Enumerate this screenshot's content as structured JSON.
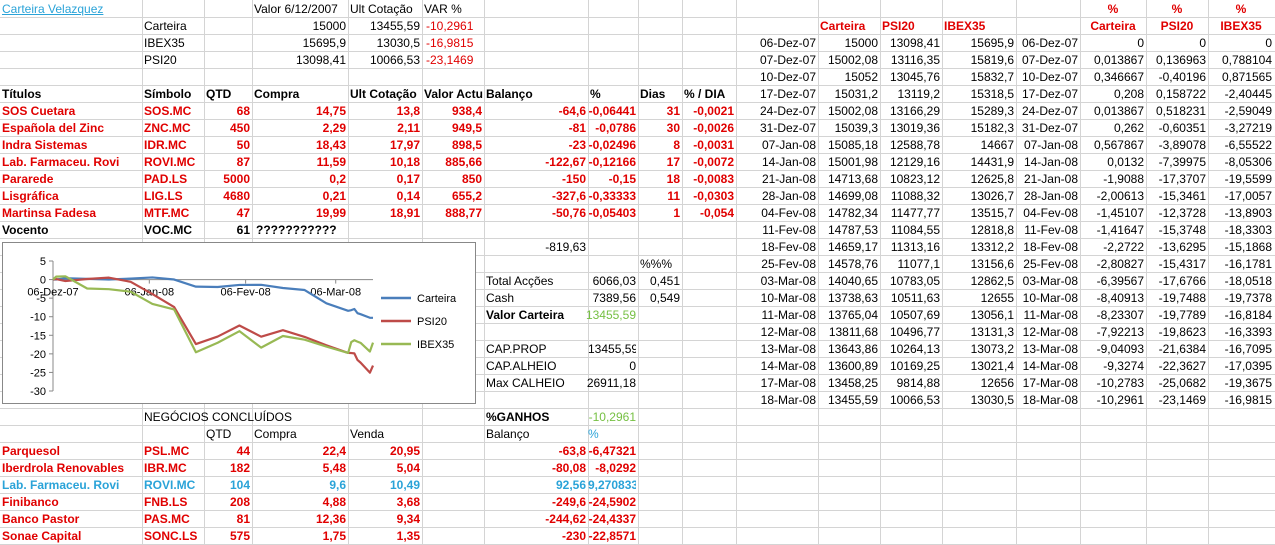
{
  "title": "Carteira Velazquez",
  "summary": {
    "headers": [
      "Valor 6/12/2007",
      "Ult Cotação",
      "VAR %"
    ],
    "rows": [
      {
        "name": "Carteira",
        "v1": "15000",
        "v2": "13455,59",
        "v3": "-10,2961"
      },
      {
        "name": "IBEX35",
        "v1": "15695,9",
        "v2": "13030,5",
        "v3": "-16,9815"
      },
      {
        "name": "PSI20",
        "v1": "13098,41",
        "v2": "10066,53",
        "v3": "-23,1469"
      }
    ]
  },
  "portfolio": {
    "headers": [
      "Títulos",
      "Símbolo",
      "QTD",
      "Compra",
      "Ult Cotação",
      "Valor Actu",
      "Balanço",
      "%",
      "Dias",
      "% / DIA"
    ],
    "rows": [
      [
        "SOS Cuetara",
        "SOS.MC",
        "68",
        "14,75",
        "13,8",
        "938,4",
        "-64,6",
        "-0,06441",
        "31",
        "-0,0021"
      ],
      [
        "Española del Zinc",
        "ZNC.MC",
        "450",
        "2,29",
        "2,11",
        "949,5",
        "-81",
        "-0,0786",
        "30",
        "-0,0026"
      ],
      [
        "Indra Sistemas",
        "IDR.MC",
        "50",
        "18,43",
        "17,97",
        "898,5",
        "-23",
        "-0,02496",
        "8",
        "-0,0031"
      ],
      [
        "Lab. Farmaceu. Rovi",
        "ROVI.MC",
        "87",
        "11,59",
        "10,18",
        "885,66",
        "-122,67",
        "-0,12166",
        "17",
        "-0,0072"
      ],
      [
        "Pararede",
        "PAD.LS",
        "5000",
        "0,2",
        "0,17",
        "850",
        "-150",
        "-0,15",
        "18",
        "-0,0083"
      ],
      [
        "Lisgráfica",
        "LIG.LS",
        "4680",
        "0,21",
        "0,14",
        "655,2",
        "-327,6",
        "-0,33333",
        "11",
        "-0,0303"
      ],
      [
        "Martinsa Fadesa",
        "MTF.MC",
        "47",
        "19,99",
        "18,91",
        "888,77",
        "-50,76",
        "-0,05403",
        "1",
        "-0,054"
      ]
    ],
    "vocento": [
      "Vocento",
      "VOC.MC",
      "61",
      "???????????"
    ]
  },
  "totals": {
    "balance_total": "-819,63",
    "pct_header": "%%%",
    "total_accoes_label": "Total Acções",
    "total_accoes": "6066,03",
    "total_accoes_pct": "0,451",
    "cash_label": "Cash",
    "cash": "7389,56",
    "cash_pct": "0,549",
    "valor_carteira_label": "Valor Carteira",
    "valor_carteira": "13455,59",
    "cap_prop_label": "CAP.PROP",
    "cap_prop": "13455,59",
    "cap_alheio_label": "CAP.ALHEIO",
    "cap_alheio": "0",
    "max_calheio_label": "Max CALHEIO",
    "max_calheio": "26911,18",
    "ganhos_label": "%GANHOS",
    "ganhos": "-10,2961",
    "balanco_label": "Balanço",
    "balanco_pct_label": "%"
  },
  "closed": {
    "title": "NEGÓCIOS CONCLUÍDOS",
    "headers": [
      "QTD",
      "Compra",
      "Venda"
    ],
    "rows": [
      [
        "Parquesol",
        "PSL.MC",
        "44",
        "22,4",
        "20,95",
        "-63,8",
        "-6,47321"
      ],
      [
        "Iberdrola Renovables",
        "IBR.MC",
        "182",
        "5,48",
        "5,04",
        "-80,08",
        "-8,0292"
      ],
      [
        "Lab. Farmaceu. Rovi",
        "ROVI.MC",
        "104",
        "9,6",
        "10,49",
        "92,56",
        "9,270833"
      ],
      [
        "Finibanco",
        "FNB.LS",
        "208",
        "4,88",
        "3,68",
        "-249,6",
        "-24,5902"
      ],
      [
        "Banco Pastor",
        "PAS.MC",
        "81",
        "12,36",
        "9,34",
        "-244,62",
        "-24,4337"
      ],
      [
        "Sonae Capital",
        "SONC.LS",
        "575",
        "1,75",
        "1,35",
        "-230",
        "-22,8571"
      ]
    ]
  },
  "history": {
    "headers": [
      "Carteira",
      "PSI20",
      "IBEX35"
    ],
    "pct_headers": [
      "%",
      "%",
      "%"
    ],
    "pct_names": [
      "Carteira",
      "PSI20",
      "IBEX35"
    ],
    "rows": [
      [
        "06-Dez-07",
        "15000",
        "13098,41",
        "15695,9",
        "06-Dez-07",
        "0",
        "0",
        "0"
      ],
      [
        "07-Dez-07",
        "15002,08",
        "13116,35",
        "15819,6",
        "07-Dez-07",
        "0,013867",
        "0,136963",
        "0,788104"
      ],
      [
        "10-Dez-07",
        "15052",
        "13045,76",
        "15832,7",
        "10-Dez-07",
        "0,346667",
        "-0,40196",
        "0,871565"
      ],
      [
        "17-Dez-07",
        "15031,2",
        "13119,2",
        "15318,5",
        "17-Dez-07",
        "0,208",
        "0,158722",
        "-2,40445"
      ],
      [
        "24-Dez-07",
        "15002,08",
        "13166,29",
        "15289,3",
        "24-Dez-07",
        "0,013867",
        "0,518231",
        "-2,59049"
      ],
      [
        "31-Dez-07",
        "15039,3",
        "13019,36",
        "15182,3",
        "31-Dez-07",
        "0,262",
        "-0,60351",
        "-3,27219"
      ],
      [
        "07-Jan-08",
        "15085,18",
        "12588,78",
        "14667",
        "07-Jan-08",
        "0,567867",
        "-3,89078",
        "-6,55522"
      ],
      [
        "14-Jan-08",
        "15001,98",
        "12129,16",
        "14431,9",
        "14-Jan-08",
        "0,0132",
        "-7,39975",
        "-8,05306"
      ],
      [
        "21-Jan-08",
        "14713,68",
        "10823,12",
        "12625,8",
        "21-Jan-08",
        "-1,9088",
        "-17,3707",
        "-19,5599"
      ],
      [
        "28-Jan-08",
        "14699,08",
        "11088,32",
        "13026,7",
        "28-Jan-08",
        "-2,00613",
        "-15,3461",
        "-17,0057"
      ],
      [
        "04-Fev-08",
        "14782,34",
        "11477,77",
        "13515,7",
        "04-Fev-08",
        "-1,45107",
        "-12,3728",
        "-13,8903"
      ],
      [
        "11-Fev-08",
        "14787,53",
        "11084,55",
        "12818,8",
        "11-Fev-08",
        "-1,41647",
        "-15,3748",
        "-18,3303"
      ],
      [
        "18-Fev-08",
        "14659,17",
        "11313,16",
        "13312,2",
        "18-Fev-08",
        "-2,2722",
        "-13,6295",
        "-15,1868"
      ],
      [
        "25-Fev-08",
        "14578,76",
        "11077,1",
        "13156,6",
        "25-Fev-08",
        "-2,80827",
        "-15,4317",
        "-16,1781"
      ],
      [
        "03-Mar-08",
        "14040,65",
        "10783,05",
        "12862,5",
        "03-Mar-08",
        "-6,39567",
        "-17,6766",
        "-18,0518"
      ],
      [
        "10-Mar-08",
        "13738,63",
        "10511,63",
        "12655",
        "10-Mar-08",
        "-8,40913",
        "-19,7488",
        "-19,7378"
      ],
      [
        "11-Mar-08",
        "13765,04",
        "10507,69",
        "13056,1",
        "11-Mar-08",
        "-8,23307",
        "-19,7789",
        "-16,8184"
      ],
      [
        "12-Mar-08",
        "13811,68",
        "10496,77",
        "13131,3",
        "12-Mar-08",
        "-7,92213",
        "-19,8623",
        "-16,3393"
      ],
      [
        "13-Mar-08",
        "13643,86",
        "10264,13",
        "13073,2",
        "13-Mar-08",
        "-9,04093",
        "-21,6384",
        "-16,7095"
      ],
      [
        "14-Mar-08",
        "13600,89",
        "10169,25",
        "13021,4",
        "14-Mar-08",
        "-9,3274",
        "-22,3627",
        "-17,0395"
      ],
      [
        "17-Mar-08",
        "13458,25",
        "9814,88",
        "12656",
        "17-Mar-08",
        "-10,2783",
        "-25,0682",
        "-19,3675"
      ],
      [
        "18-Mar-08",
        "13455,59",
        "10066,53",
        "13030,5",
        "18-Mar-08",
        "-10,2961",
        "-23,1469",
        "-16,9815"
      ]
    ]
  },
  "chart_data": {
    "type": "line",
    "x": [
      "06-Dez-07",
      "07-Dez-07",
      "10-Dez-07",
      "17-Dez-07",
      "24-Dez-07",
      "31-Dez-07",
      "07-Jan-08",
      "14-Jan-08",
      "21-Jan-08",
      "28-Jan-08",
      "04-Fev-08",
      "11-Fev-08",
      "18-Fev-08",
      "25-Fev-08",
      "03-Mar-08",
      "10-Mar-08",
      "11-Mar-08",
      "12-Mar-08",
      "13-Mar-08",
      "14-Mar-08",
      "17-Mar-08",
      "18-Mar-08"
    ],
    "x_numeric_days": [
      0,
      1,
      4,
      11,
      18,
      25,
      32,
      39,
      46,
      53,
      60,
      67,
      74,
      81,
      88,
      95,
      96,
      97,
      98,
      99,
      102,
      103
    ],
    "x_tick_labels": [
      "06-Dez-07",
      "06-Jan-08",
      "06-Fev-08",
      "06-Mar-08"
    ],
    "x_tick_days": [
      0,
      31,
      62,
      91
    ],
    "y_ticks": [
      "5",
      "0",
      "-5",
      "-10",
      "-15",
      "-20",
      "-25",
      "-30"
    ],
    "ylim": [
      -30,
      5
    ],
    "legend_position": "right",
    "series": [
      {
        "name": "Carteira",
        "color": "#4a7ebb",
        "values": [
          0,
          0.013867,
          0.346667,
          0.208,
          0.013867,
          0.262,
          0.567867,
          0.0132,
          -1.9088,
          -2.00613,
          -1.45107,
          -1.41647,
          -2.2722,
          -2.80827,
          -6.39567,
          -8.40913,
          -8.23307,
          -7.92213,
          -9.04093,
          -9.3274,
          -10.2783,
          -10.2961
        ]
      },
      {
        "name": "PSI20",
        "color": "#be4b48",
        "values": [
          0,
          0.136963,
          -0.40196,
          0.158722,
          0.518231,
          -0.60351,
          -3.89078,
          -7.39975,
          -17.3707,
          -15.3461,
          -12.3728,
          -15.3748,
          -13.6295,
          -15.4317,
          -17.6766,
          -19.7488,
          -19.7789,
          -19.8623,
          -21.6384,
          -22.3627,
          -25.0682,
          -23.1469
        ]
      },
      {
        "name": "IBEX35",
        "color": "#98b954",
        "values": [
          0,
          0.788104,
          0.871565,
          -2.40445,
          -2.59049,
          -3.27219,
          -6.55522,
          -8.05306,
          -19.5599,
          -17.0057,
          -13.8903,
          -18.3303,
          -15.1868,
          -16.1781,
          -18.0518,
          -19.7378,
          -16.8184,
          -16.3393,
          -16.7095,
          -17.0395,
          -19.3675,
          -16.9815
        ]
      }
    ]
  }
}
